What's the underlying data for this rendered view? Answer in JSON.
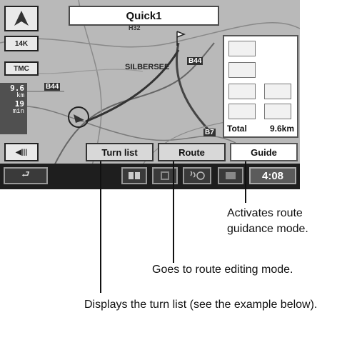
{
  "screen": {
    "title": "Quick1",
    "left_buttons": {
      "heading_label": "N",
      "scale_label": "14K",
      "tmc_label": "TMC",
      "back_label": "◀|||"
    },
    "distance_panel": {
      "top_value": "9.6",
      "top_unit": "km",
      "bottom_value": "19",
      "bottom_unit": "min"
    },
    "map_labels": {
      "town": "SILBERSEE",
      "road_a": "B44",
      "road_b": "B44",
      "road_c": "B7",
      "road_d": "H32"
    },
    "route_panel": {
      "total_label": "Total",
      "total_value": "9.6km"
    },
    "buttons": {
      "turn_list": "Turn list",
      "route": "Route",
      "guide": "Guide"
    },
    "bottom_bar": {
      "back_icon": "⮐",
      "clock": "4:08"
    }
  },
  "callouts": {
    "guide": "Activates route guidance mode.",
    "route": "Goes to route editing mode.",
    "turn_list": "Displays the turn list (see the example below)."
  }
}
